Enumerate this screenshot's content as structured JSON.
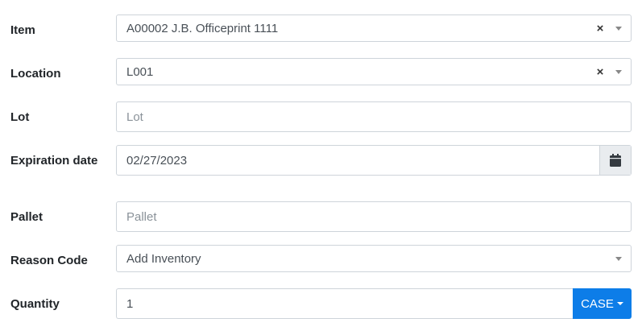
{
  "colors": {
    "accent": "#0d7de8",
    "border": "#ced4da",
    "addon_bg": "#e9ecef"
  },
  "fields": {
    "item": {
      "label": "Item",
      "value": "A00002 J.B. Officeprint 1111",
      "clear": "×"
    },
    "location": {
      "label": "Location",
      "value": "L001",
      "clear": "×"
    },
    "lot": {
      "label": "Lot",
      "placeholder": "Lot",
      "value": ""
    },
    "expiration": {
      "label": "Expiration date",
      "value": "02/27/2023",
      "icon": "calendar-icon"
    },
    "pallet": {
      "label": "Pallet",
      "placeholder": "Pallet",
      "value": ""
    },
    "reason": {
      "label": "Reason Code",
      "value": "Add Inventory"
    },
    "quantity": {
      "label": "Quantity",
      "value": "1",
      "unit": "CASE"
    }
  }
}
